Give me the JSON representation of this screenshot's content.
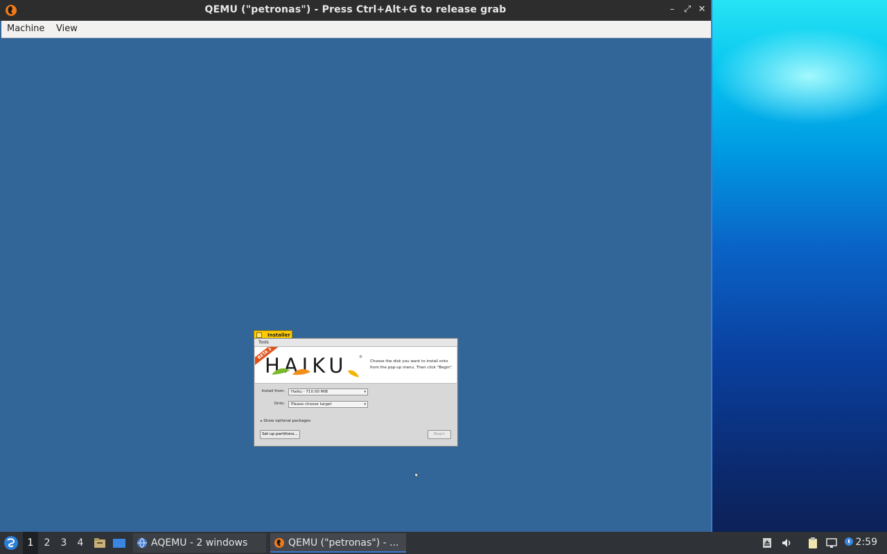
{
  "window": {
    "title": "QEMU (\"petronas\") - Press Ctrl+Alt+G to release grab",
    "minimize_glyph": "–",
    "maximize_glyph": "⤢",
    "close_glyph": "✕"
  },
  "menubar": {
    "items": [
      {
        "label": "Machine"
      },
      {
        "label": "View"
      }
    ]
  },
  "installer": {
    "tab_title": "Installer",
    "menu": {
      "tools": "Tools"
    },
    "logo_text": "HAIKU",
    "reg_mark": "®",
    "beta_badge": "BETA 3",
    "instruction": "Choose the disk you want to install onto from the pop-up menu. Then click \"Begin\".",
    "install_from_label": "Install from:",
    "install_from_value": "Haiku - 710.00 MiB",
    "onto_label": "Onto:",
    "onto_value": "Please choose target",
    "optional_packages": "Show optional packages",
    "setup_partitions_label": "Set up partitions...",
    "begin_label": "Begin"
  },
  "taskbar": {
    "workspaces": [
      "1",
      "2",
      "3",
      "4"
    ],
    "active_workspace": "1",
    "tasks": [
      {
        "label": "AQEMU - 2 windows",
        "icon": "globe-icon"
      },
      {
        "label": "QEMU (\"petronas\") - ...",
        "icon": "qemu-icon"
      }
    ],
    "clock": "2:59"
  },
  "colors": {
    "vm_background": "#336698",
    "titlebar": "#2d2d2d",
    "taskbar": "#2f3236",
    "haiku_tab": "#ffcb00",
    "accent": "#3b7bd0"
  }
}
